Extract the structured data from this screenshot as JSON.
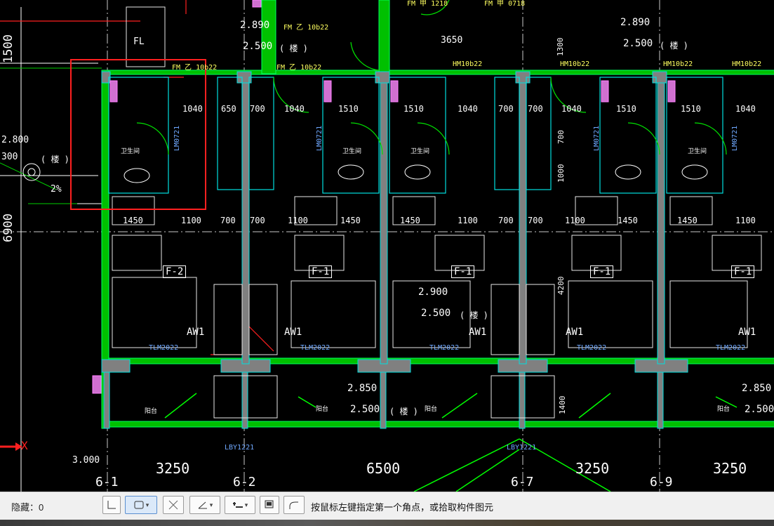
{
  "statusbar": {
    "hidden_label": "隐藏：0",
    "prompt": "按鼠标左键指定第一个角点，或拾取构件图元",
    "buttons": [
      {
        "name": "orthogonal-button",
        "icon": "corner-icon"
      },
      {
        "name": "rectangle-select-button",
        "icon": "rectangle-icon",
        "has_dropdown": true,
        "active": true
      },
      {
        "name": "cross-select-button",
        "icon": "cross-icon"
      },
      {
        "name": "angle-button",
        "icon": "angle-icon",
        "has_dropdown": true
      },
      {
        "name": "offset-button",
        "icon": "offset-icon",
        "has_dropdown": true
      },
      {
        "name": "display-button",
        "icon": "display-icon"
      },
      {
        "name": "arc-button",
        "icon": "arc-icon"
      }
    ]
  },
  "drawing": {
    "axis_labels": [
      "6-1",
      "6-2",
      "6-7",
      "6-9"
    ],
    "axis_x_label": "X",
    "bottom_dims": [
      "3250",
      "6500",
      "3250",
      "3250"
    ],
    "left_dims": [
      "1500",
      "6900"
    ],
    "room_tags": [
      "F-2",
      "F-1",
      "F-1",
      "F-1",
      "F-1"
    ],
    "aw_tags": [
      "AW1",
      "AW1",
      "AW1",
      "AW1",
      "AW1"
    ],
    "tlm_tags": [
      "TLM2022",
      "TLM2022",
      "TLM2022",
      "TLM2022",
      "TLM2022"
    ],
    "lm_tags": [
      "LM0721",
      "LM0721",
      "LM0721",
      "LM0721"
    ],
    "hm_tags": [
      "HM10b22",
      "HM10b22",
      "HM10b22",
      "HM10b22"
    ],
    "fm_tags": [
      "FM 乙 10b22",
      "FM 乙 10b22",
      "FM 甲 1218",
      "FM 甲 0718"
    ],
    "lby_tags": [
      "LBY1221",
      "LBY1221"
    ],
    "elevations_top": [
      "2.890",
      "2.500",
      "2.890",
      "2.500"
    ],
    "elevations_mid": [
      "2.900",
      "2.500"
    ],
    "elevations_low": [
      "2.850",
      "2.500",
      "2.850",
      "2.500"
    ],
    "elevation_left": [
      "2.800",
      "300",
      "3.000"
    ],
    "elev_suffix": "( 楼 )",
    "top_dims": [
      "3650",
      "1300"
    ],
    "row1_dims": [
      "1040",
      "650",
      "700",
      "1040",
      "1510",
      "1510",
      "1040",
      "700",
      "700",
      "1040",
      "1510",
      "1510",
      "1040"
    ],
    "row2_dims": [
      "1450",
      "1100",
      "700",
      "700",
      "1100",
      "1450",
      "1450",
      "1100",
      "700",
      "700",
      "1100",
      "1450",
      "1450",
      "1100"
    ],
    "vertical_dims": [
      "700",
      "1000",
      "4200",
      "1400"
    ],
    "fl_label": "FL",
    "slope_label": "2%",
    "chinese_labels": [
      "卫生间",
      "卫生间",
      "卫生间",
      "卫生间",
      "阳台",
      "阳台",
      "阳台",
      "阳台"
    ]
  }
}
